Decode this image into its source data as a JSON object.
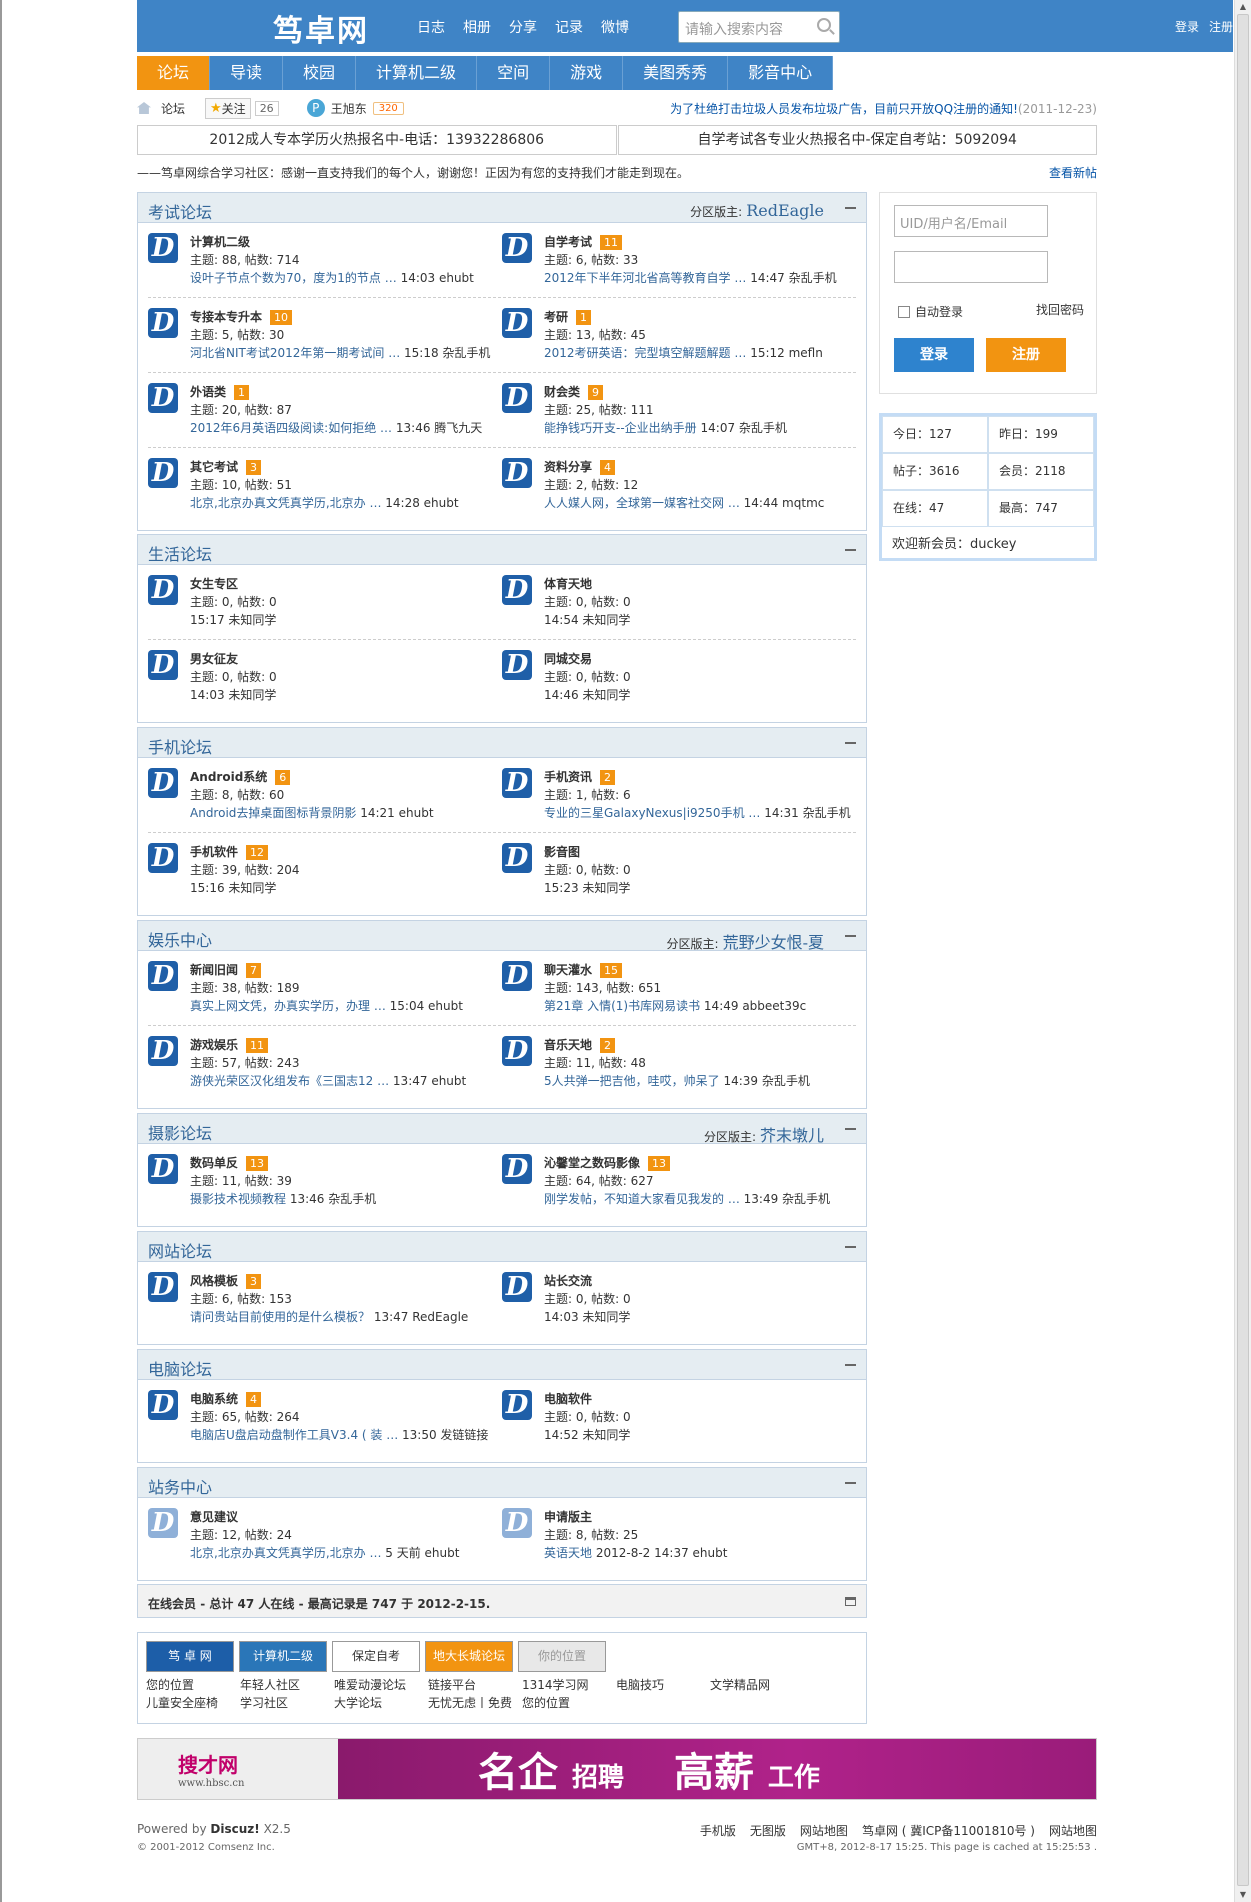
{
  "header": {
    "logo": "笃卓网",
    "nav": [
      "日志",
      "相册",
      "分享",
      "记录",
      "微博"
    ],
    "search_placeholder": "请输入搜索内容",
    "login": "登录",
    "register": "注册"
  },
  "mainnav": [
    "论坛",
    "导读",
    "校园",
    "计算机二级",
    "空间",
    "游戏",
    "美图秀秀",
    "影音中心"
  ],
  "crumb": {
    "current": "论坛",
    "follow": "关注",
    "follow_count": "26",
    "user": "王旭东",
    "user_count": "320",
    "notice": "为了杜绝打击垃圾人员发布垃圾广告，目前只开放QQ注册的通知!",
    "notice_date": "(2011-12-23)"
  },
  "ads": [
    "2012成人专本学历火热报名中-电话：13932286806",
    "自学考试各专业火热报名中-保定自考站：5092094"
  ],
  "thanks": "——笃卓网综合学习社区：感谢一直支持我们的每个人，谢谢您！正因为有您的支持我们才能走到现在。",
  "thanks_link": "查看新帖",
  "mod_label": "分区版主:",
  "sections": [
    {
      "title": "考试论坛",
      "mod": "RedEagle",
      "rows": [
        [
          {
            "name": "计算机二级",
            "badge": "",
            "stat": "主题: 88, 帖数: 714",
            "link": "设叶子节点个数为70，度为1的节点 …",
            "time": "14:03 ehubt"
          },
          {
            "name": "自学考试",
            "badge": "11",
            "stat": "主题: 6, 帖数: 33",
            "link": "2012年下半年河北省高等教育自学 …",
            "time": "14:47 杂乱手机"
          }
        ],
        [
          {
            "name": "专接本专升本",
            "badge": "10",
            "stat": "主题: 5, 帖数: 30",
            "link": "河北省NIT考试2012年第一期考试间 …",
            "time": "15:18 杂乱手机"
          },
          {
            "name": "考研",
            "badge": "1",
            "stat": "主题: 13, 帖数: 45",
            "link": "2012考研英语：完型填空解题解题 …",
            "time": "15:12 mefln"
          }
        ],
        [
          {
            "name": "外语类",
            "badge": "1",
            "stat": "主题: 20, 帖数: 87",
            "link": "2012年6月英语四级阅读:如何拒绝 …",
            "time": "13:46 腾飞九天"
          },
          {
            "name": "财会类",
            "badge": "9",
            "stat": "主题: 25, 帖数: 111",
            "link": "能挣钱巧开支--企业出纳手册",
            "time": "14:07 杂乱手机"
          }
        ],
        [
          {
            "name": "其它考试",
            "badge": "3",
            "stat": "主题: 10, 帖数: 51",
            "link": "北京,北京办真文凭真学历,北京办 …",
            "time": "14:28 ehubt"
          },
          {
            "name": "资料分享",
            "badge": "4",
            "stat": "主题: 2, 帖数: 12",
            "link": "人人媒人网，全球第一媒客社交网 …",
            "time": "14:44 mqtmc"
          }
        ]
      ]
    },
    {
      "title": "生活论坛",
      "mod": "",
      "rows": [
        [
          {
            "name": "女生专区",
            "badge": "",
            "stat": "主题: 0, 帖数: 0",
            "link": "",
            "time": "15:17 未知同学"
          },
          {
            "name": "体育天地",
            "badge": "",
            "stat": "主题: 0, 帖数: 0",
            "link": "",
            "time": "14:54 未知同学"
          }
        ],
        [
          {
            "name": "男女征友",
            "badge": "",
            "stat": "主题: 0, 帖数: 0",
            "link": "",
            "time": "14:03 未知同学"
          },
          {
            "name": "同城交易",
            "badge": "",
            "stat": "主题: 0, 帖数: 0",
            "link": "",
            "time": "14:46 未知同学"
          }
        ]
      ]
    },
    {
      "title": "手机论坛",
      "mod": "",
      "rows": [
        [
          {
            "name": "Android系统",
            "badge": "6",
            "stat": "主题: 8, 帖数: 60",
            "link": "Android去掉桌面图标背景阴影",
            "time": "14:21 ehubt"
          },
          {
            "name": "手机资讯",
            "badge": "2",
            "stat": "主题: 1, 帖数: 6",
            "link": "专业的三星GalaxyNexus|i9250手机 …",
            "time": "14:31 杂乱手机"
          }
        ],
        [
          {
            "name": "手机软件",
            "badge": "12",
            "stat": "主题: 39, 帖数: 204",
            "link": "",
            "time": "15:16 未知同学"
          },
          {
            "name": "影音图",
            "badge": "",
            "stat": "主题: 0, 帖数: 0",
            "link": "",
            "time": "15:23 未知同学"
          }
        ]
      ]
    },
    {
      "title": "娱乐中心",
      "mod": "荒野少女恨-夏",
      "rows": [
        [
          {
            "name": "新闻旧闻",
            "badge": "7",
            "stat": "主题: 38, 帖数: 189",
            "link": "真实上网文凭，办真实学历，办理 …",
            "time": "15:04 ehubt"
          },
          {
            "name": "聊天灌水",
            "badge": "15",
            "stat": "主题: 143, 帖数: 651",
            "link": "第21章 入情(1)书库网易读书",
            "time": "14:49 abbeet39c"
          }
        ],
        [
          {
            "name": "游戏娱乐",
            "badge": "11",
            "stat": "主题: 57, 帖数: 243",
            "link": "游侠光荣区汉化组发布《三国志12 …",
            "time": "13:47 ehubt"
          },
          {
            "name": "音乐天地",
            "badge": "2",
            "stat": "主题: 11, 帖数: 48",
            "link": "5人共弹一把吉他，哇哎，帅呆了",
            "time": "14:39 杂乱手机"
          }
        ]
      ]
    },
    {
      "title": "摄影论坛",
      "mod": "芥末墩儿",
      "rows": [
        [
          {
            "name": "数码单反",
            "badge": "13",
            "stat": "主题: 11, 帖数: 39",
            "link": "摄影技术视频教程",
            "time": "13:46 杂乱手机"
          },
          {
            "name": "沁馨堂之数码影像",
            "badge": "13",
            "stat": "主题: 64, 帖数: 627",
            "link": "刚学发帖，不知道大家看见我发的 …",
            "time": "13:49 杂乱手机"
          }
        ]
      ]
    },
    {
      "title": "网站论坛",
      "mod": "",
      "rows": [
        [
          {
            "name": "风格模板",
            "badge": "3",
            "stat": "主题: 6, 帖数: 153",
            "link": "请问贵站目前使用的是什么模板？",
            "time": "13:47 RedEagle"
          },
          {
            "name": "站长交流",
            "badge": "",
            "stat": "主题: 0, 帖数: 0",
            "link": "",
            "time": "14:03 未知同学"
          }
        ]
      ]
    },
    {
      "title": "电脑论坛",
      "mod": "",
      "rows": [
        [
          {
            "name": "电脑系统",
            "badge": "4",
            "stat": "主题: 65, 帖数: 264",
            "link": "电脑店U盘启动盘制作工具V3.4 ( 装 …",
            "time": "13:50 发链链接"
          },
          {
            "name": "电脑软件",
            "badge": "",
            "stat": "主题: 0, 帖数: 0",
            "link": "",
            "time": "14:52 未知同学"
          }
        ]
      ]
    },
    {
      "title": "站务中心",
      "mod": "",
      "rows": [
        [
          {
            "name": "意见建议",
            "badge": "",
            "stat": "主题: 12, 帖数: 24",
            "link": "北京,北京办真文凭真学历,北京办 …",
            "time": "5 天前  ehubt"
          },
          {
            "name": "申请版主",
            "badge": "",
            "stat": "主题: 8, 帖数: 25",
            "link": "英语天地",
            "time": "2012-8-2 14:37 ehubt"
          }
        ]
      ]
    }
  ],
  "login": {
    "uid_placeholder": "UID/用户名/Email",
    "auto": "自动登录",
    "findpw": "找回密码",
    "login_btn": "登录",
    "reg_btn": "注册"
  },
  "stats": {
    "today": "今日：127",
    "yesterday": "昨日：199",
    "posts": "帖子：3616",
    "members": "会员：2118",
    "online": "在线：47",
    "peak": "最高：747",
    "welcome": "欢迎新会员：duckey"
  },
  "online": {
    "label": "在线会员",
    "text": " - 总计  47 人在线  - 最高记录是  747 于  2012-2-15."
  },
  "links": {
    "buttons": [
      "笃 卓 网",
      "计算机二级",
      "保定自考",
      "地大长城论坛",
      "你的位置"
    ],
    "text": [
      "您的位置",
      "年轻人社区",
      "唯爱动漫论坛",
      "链接平台",
      "1314学习网",
      "电脑技巧",
      "文学精品网",
      "儿童安全座椅",
      "学习社区",
      "大学论坛",
      "无忧无虑丨免费",
      "您的位置"
    ]
  },
  "banner": {
    "site": "搜才网",
    "url": "www.hbsc.cn",
    "t1": "名企",
    "t1b": "招聘",
    "t2": "高薪",
    "t2b": "工作"
  },
  "footer": {
    "powered": "Powered by",
    "brand": "Discuz!",
    "ver": "X2.5",
    "copy": "© 2001-2012 Comsenz Inc.",
    "links": [
      "手机版",
      "无图版",
      "网站地图",
      "笃卓网 ( 冀ICP备11001810号 )",
      "网站地图"
    ],
    "cache": "GMT+8, 2012-8-17 15:25. This page is cached at 15:25:53 ."
  }
}
